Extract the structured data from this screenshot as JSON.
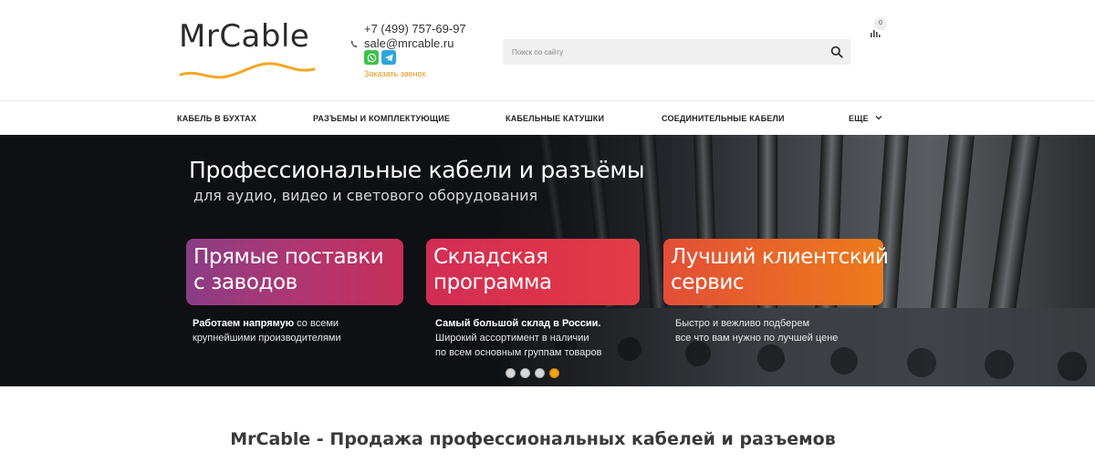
{
  "header": {
    "logo_text": "MrCable",
    "phone": "+7 (499) 757-69-97",
    "email": "sale@mrcable.ru",
    "callback": "Заказать звонок",
    "search_placeholder": "Поиск по сайту",
    "cart_count": "0"
  },
  "nav": {
    "items": [
      {
        "label": "КАБЕЛЬ В БУХТАХ"
      },
      {
        "label": "РАЗЪЕМЫ И КОМПЛЕКТУЮЩИЕ"
      },
      {
        "label": "КАБЕЛЬНЫЕ КАТУШКИ"
      },
      {
        "label": "СОЕДИНИТЕЛЬНЫЕ КАБЕЛИ"
      },
      {
        "label": "ЕЩЕ"
      }
    ]
  },
  "banner": {
    "title": "Профессиональные кабели и разъёмы",
    "subtitle": "для аудио, видео и светового оборудования",
    "cards": [
      {
        "line1": "Прямые поставки",
        "line2": "с заводов"
      },
      {
        "line1": "Складская",
        "line2": "программа"
      },
      {
        "line1": "Лучший клиентский",
        "line2": "сервис"
      }
    ],
    "descriptions": [
      {
        "bold": "Работаем напрямую",
        "line1_rest": " со всеми",
        "line2": "крупнейшими производителями",
        "line3": ""
      },
      {
        "bold": "Самый большой склад в России.",
        "line1_rest": "",
        "line2": "Широкий ассортимент в наличии",
        "line3": "по всем основным группам товаров"
      },
      {
        "bold": "",
        "line1_rest": "Быстро и вежливо подберем",
        "line2": "все что вам нужно по лучшей цене",
        "line3": ""
      }
    ],
    "slides_total": 4,
    "active_slide": 4
  },
  "page_heading": "MrCable - Продажа профессиональных кабелей и разъемов",
  "colors": {
    "accent_orange": "#f0a21a",
    "callback_orange": "#e8961c",
    "whatsapp_green": "#3ec14b",
    "telegram_blue": "#2ea6dd"
  },
  "icons": [
    "phone-icon",
    "whatsapp-icon",
    "telegram-icon",
    "search-icon",
    "cart-icon",
    "chevron-down-icon"
  ]
}
